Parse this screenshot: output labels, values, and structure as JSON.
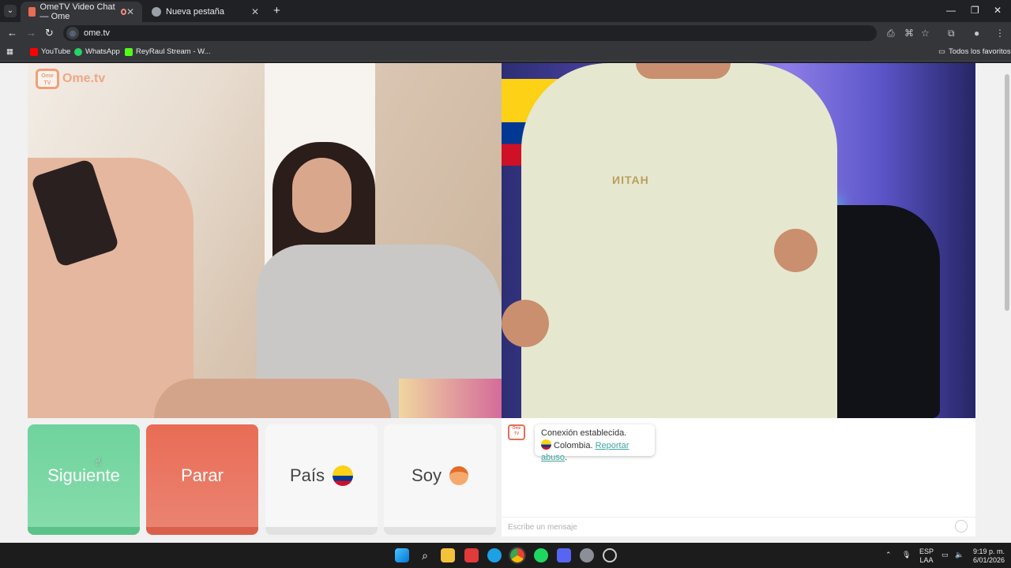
{
  "browser": {
    "tabs": [
      {
        "title": "OmeTV Video Chat — Ome",
        "active": true
      },
      {
        "title": "Nueva pestaña",
        "active": false
      }
    ],
    "url": "ome.tv",
    "bookmarks": [
      "YouTube",
      "WhatsApp",
      "ReyRaul Stream - W..."
    ],
    "all_bookmarks": "Todos los favoritos"
  },
  "app": {
    "logo_badge": "Ome TV",
    "logo_text": "Ome.tv",
    "buttons": {
      "next": "Siguiente",
      "stop": "Parar",
      "country": "País",
      "gender": "Soy"
    },
    "chat": {
      "message_line1": "Conexión establecida.",
      "country": "Colombia.",
      "report": "Reportar abuso",
      "report_suffix": ".",
      "placeholder": "Escribe un mensaje"
    },
    "colors": {
      "next": "#6fd39d",
      "stop": "#e96c55",
      "brand": "#f0a07a",
      "link": "#3ca5a2"
    }
  },
  "taskbar": {
    "lang_top": "ESP",
    "lang_bottom": "LAA",
    "time": "9:19 p. m.",
    "date": "6/01/2026"
  }
}
